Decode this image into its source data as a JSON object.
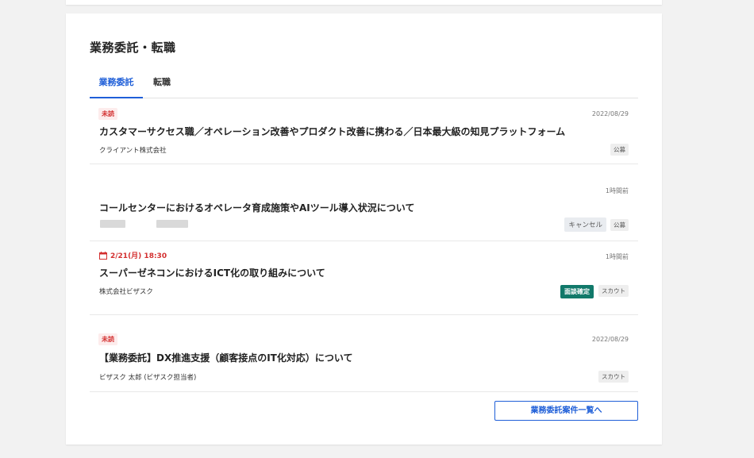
{
  "section": {
    "title": "業務委託・転職"
  },
  "tabs": [
    {
      "label": "業務委託"
    },
    {
      "label": "転職"
    }
  ],
  "items": [
    {
      "badge": "未読",
      "date": "2022/08/29",
      "title": "カスタマーサクセス職／オペレーション改善やプロダクト改善に携わる／日本最大級の知見プラットフォーム",
      "company": "クライアント株式会社",
      "tags": [
        "公募"
      ]
    },
    {
      "date": "1時間前",
      "title": "コールセンターにおけるオペレータ育成施策やAIツール導入状況について",
      "tags": [
        "キャンセル",
        "公募"
      ]
    },
    {
      "interview": "2/21(月) 18:30",
      "date": "1時間前",
      "title": "スーパーゼネコンにおけるICT化の取り組みについて",
      "company": "株式会社ビザスク",
      "tags": [
        "面談確定",
        "スカウト"
      ]
    },
    {
      "badge": "未読",
      "date": "2022/08/29",
      "title": "【業務委託】DX推進支援（顧客接点のIT化対応）について",
      "company": "ビザスク 太郎 (ビザスク担当者)",
      "tags": [
        "スカウト"
      ]
    }
  ],
  "footer": {
    "button_label": "業務委託案件一覧へ"
  },
  "colors": {
    "accent": "#1f5fd8",
    "unread": "#d32f2f",
    "confirmed": "#11796a"
  }
}
